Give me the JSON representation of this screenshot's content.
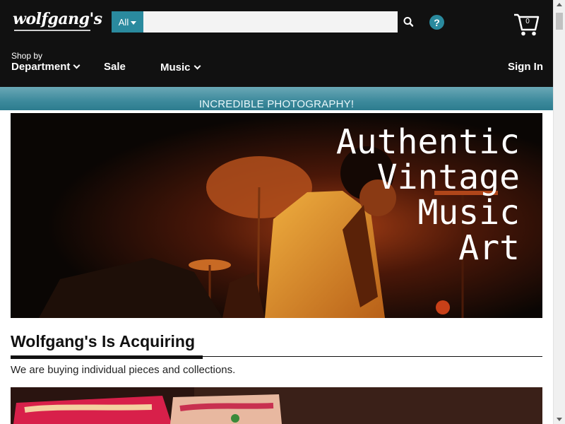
{
  "header": {
    "logo_text": "wolfgang's",
    "search": {
      "category": "All",
      "value": "",
      "placeholder": ""
    },
    "help_label": "?",
    "cart_count": "0"
  },
  "nav": {
    "shop_by": "Shop by",
    "department": "Department",
    "sale": "Sale",
    "music": "Music",
    "sign_in": "Sign In"
  },
  "promo": {
    "text": "INCREDIBLE PHOTOGRAPHY!"
  },
  "hero": {
    "lines": [
      "Authentic",
      "Vintage",
      "Music",
      "Art"
    ]
  },
  "acquiring": {
    "title": "Wolfgang's Is Acquiring",
    "description": "We are buying individual pieces and collections."
  },
  "colors": {
    "header_bg": "#111111",
    "accent": "#2a8a9e",
    "promo_text": "#e8f7fa"
  },
  "icons": {
    "search": "magnifier-icon",
    "help": "question-icon",
    "cart": "shopping-cart-icon",
    "dropdown": "chevron-down-icon"
  }
}
